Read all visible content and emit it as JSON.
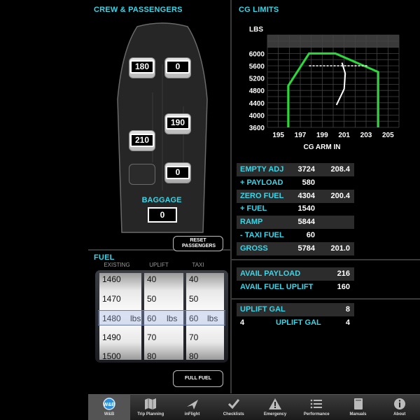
{
  "left_panel": {
    "title": "CREW & PASSENGERS",
    "seats": [
      {
        "id": "front-left",
        "value": "180"
      },
      {
        "id": "front-right",
        "value": "0"
      },
      {
        "id": "middle-right",
        "value": "190"
      },
      {
        "id": "middle-left",
        "value": "210"
      },
      {
        "id": "rear-right",
        "value": "0"
      }
    ],
    "baggage_label": "BAGGAGE",
    "baggage_value": "0",
    "reset_button": "RESET PASSENGERS"
  },
  "fuel": {
    "title": "FUEL",
    "col_existing": "EXISTING",
    "col_uplift": "UPLIFT",
    "col_taxi": "TAXI",
    "existing_rows": [
      "1460",
      "1470",
      "1480",
      "1490",
      "1500"
    ],
    "uplift_rows": [
      "40",
      "50",
      "60",
      "70",
      "80"
    ],
    "taxi_rows": [
      "40",
      "50",
      "60",
      "70",
      "80"
    ],
    "unit": "lbs",
    "full_fuel_button": "FULL FUEL"
  },
  "cg": {
    "title": "CG LIMITS"
  },
  "chart_data": {
    "type": "line",
    "title": "",
    "ylabel": "LBS",
    "xlabel": "CG ARM IN",
    "xlim": [
      194,
      206
    ],
    "ylim": [
      3600,
      6600
    ],
    "x_ticks": [
      "195",
      "197",
      "199",
      "201",
      "203",
      "205"
    ],
    "y_ticks": [
      "3600",
      "4000",
      "4400",
      "4800",
      "5200",
      "5600",
      "6000"
    ],
    "envelope": {
      "x": [
        195.9,
        195.9,
        197.8,
        200.2,
        204.1,
        204.1
      ],
      "y": [
        3600,
        4950,
        6000,
        6000,
        5400,
        3600
      ],
      "color": "#2bd93b"
    },
    "limit_line": {
      "x": [
        197.8,
        203.1
      ],
      "y": [
        5600,
        5600
      ],
      "color": "#ffffff",
      "style": "dashed"
    },
    "cg_path": {
      "x": [
        200.8,
        201.1,
        201.0,
        200.6,
        200.3
      ],
      "y": [
        5700,
        5350,
        4850,
        4550,
        4330
      ],
      "color": "#ffffff"
    },
    "grid": true
  },
  "weights": {
    "rows": [
      {
        "label": "EMPTY ADJ",
        "v1": "3724",
        "v2": "208.4",
        "dark": true
      },
      {
        "label": "+ PAYLOAD",
        "v1": "580",
        "v2": "",
        "dark": false
      },
      {
        "label": "ZERO FUEL",
        "v1": "4304",
        "v2": "200.4",
        "dark": true
      },
      {
        "label": "+  FUEL",
        "v1": "1540",
        "v2": "",
        "dark": false
      },
      {
        "label": "RAMP",
        "v1": "5844",
        "v2": "",
        "dark": true
      },
      {
        "label": "-  TAXI FUEL",
        "v1": "60",
        "v2": "",
        "dark": false
      },
      {
        "label": "GROSS",
        "v1": "5784",
        "v2": "201.0",
        "dark": true
      }
    ]
  },
  "avail": {
    "payload_label": "AVAIL PAYLOAD",
    "payload_value": "216",
    "fuel_uplift_label": "AVAIL FUEL UPLIFT",
    "fuel_uplift_value": "160"
  },
  "uplift_gal": {
    "label": "UPLIFT GAL",
    "value": "8",
    "row2_left": "4",
    "row2_label": "UPLIFT GAL",
    "row2_value": "4"
  },
  "tabs": [
    {
      "label": "W&B",
      "icon": "wb-icon",
      "active": true
    },
    {
      "label": "Trip Planning",
      "icon": "map-icon",
      "active": false
    },
    {
      "label": "inFlight",
      "icon": "plane-icon",
      "active": false
    },
    {
      "label": "Checklists",
      "icon": "checkmark-icon",
      "active": false
    },
    {
      "label": "Emergency",
      "icon": "warning-icon",
      "active": false
    },
    {
      "label": "Performance",
      "icon": "list-icon",
      "active": false
    },
    {
      "label": "Manuals",
      "icon": "book-icon",
      "active": false
    },
    {
      "label": "About",
      "icon": "info-icon",
      "active": false
    }
  ],
  "colors": {
    "accent": "#38d6e8",
    "envelope": "#2bd93b",
    "background": "#000000"
  }
}
